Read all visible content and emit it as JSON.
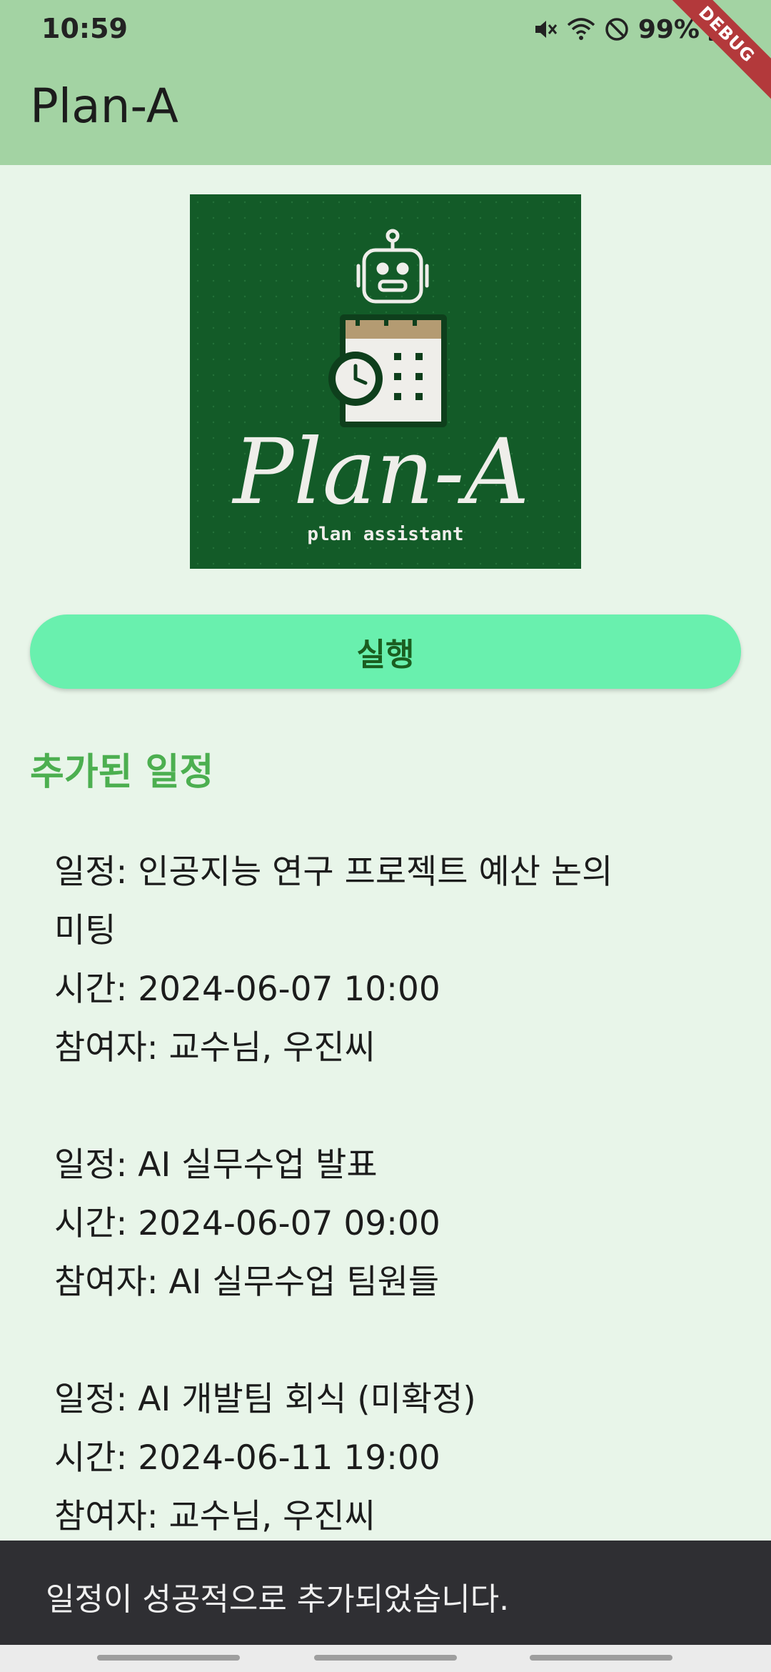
{
  "status_bar": {
    "time": "10:59",
    "battery": "99%",
    "icons": [
      "mute-icon",
      "wifi-icon",
      "do-not-disturb-icon",
      "battery-icon"
    ]
  },
  "debug_banner": "DEBUG",
  "app_bar": {
    "title": "Plan-A"
  },
  "logo": {
    "title": "Plan-A",
    "subtitle": "plan assistant",
    "colors": {
      "background": "#135b28",
      "cream": "#efeeea",
      "accent": "#b49b72"
    }
  },
  "run_button": {
    "label": "실행",
    "color": "#69f0ae"
  },
  "section": {
    "title": "추가된 일정"
  },
  "schedules": [
    {
      "lines": [
        "일정: 인공지능 연구 프로젝트 예산 논의",
        "미팅",
        "시간: 2024-06-07 10:00",
        "참여자: 교수님, 우진씨"
      ]
    },
    {
      "lines": [
        "일정: AI 실무수업 발표",
        "시간: 2024-06-07 09:00",
        "참여자: AI 실무수업 팀원들"
      ]
    },
    {
      "lines": [
        "일정: AI 개발팀 회식 (미확정)",
        "시간: 2024-06-11 19:00",
        "참여자: 교수님, 우진씨"
      ]
    }
  ],
  "snackbar": {
    "message": "일정이 성공적으로 추가되었습니다."
  }
}
